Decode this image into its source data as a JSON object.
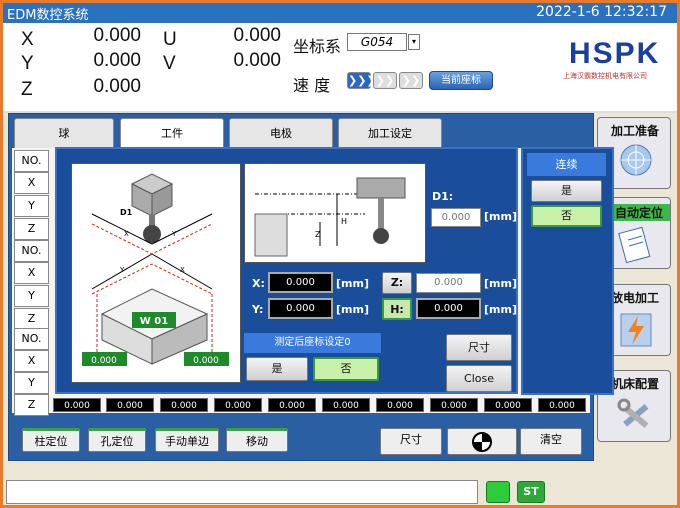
{
  "titlebar": {
    "title": "EDM数控系统",
    "datetime": "2022-1-6 12:32:17"
  },
  "axes": [
    {
      "name": "X",
      "value": "0.000"
    },
    {
      "name": "Y",
      "value": "0.000"
    },
    {
      "name": "Z",
      "value": "0.000"
    },
    {
      "name": "U",
      "value": "0.000"
    },
    {
      "name": "V",
      "value": "0.000"
    }
  ],
  "coord": {
    "label": "坐标系",
    "value": "G054"
  },
  "speed": {
    "label": "速  度",
    "btn1": "❯❯❯",
    "btn2": "❯❯",
    "btn3": "❯❯",
    "current_btn": "当前座标"
  },
  "logo": {
    "text": "HSPK",
    "subtitle": "上海汉霸数控机电有限公司"
  },
  "tabs": [
    "球",
    "工件",
    "电极",
    "加工设定"
  ],
  "rows": [
    "NO.",
    "X",
    "Y",
    "Z",
    "NO.",
    "X",
    "Y",
    "Z",
    "NO.",
    "X",
    "Y",
    "Z"
  ],
  "bottom_values": [
    "0.000",
    "0.000",
    "0.000",
    "0.000",
    "0.000",
    "0.000",
    "0.000",
    "0.000",
    "0.000",
    "0.000"
  ],
  "bottom_buttons": {
    "col": "柱定位",
    "hole": "孔定位",
    "manual": "手动单边",
    "move": "移动",
    "size": "尺寸",
    "clear": "清空"
  },
  "side": {
    "prep": "加工准备",
    "auto": "自动定位",
    "edm": "放电加工",
    "config": "机床配置"
  },
  "dialog": {
    "d1_label": "D1:",
    "d1_value": "0.000",
    "unit": "[mm]",
    "x_label": "X:",
    "x_value": "0.000",
    "y_label": "Y:",
    "y_value": "0.000",
    "z_btn": "Z:",
    "z_value": "0.000",
    "h_btn": "H:",
    "h_value": "0.000",
    "set_label": "测定后座标设定0",
    "yes": "是",
    "no": "否",
    "size": "尺寸",
    "close": "Close",
    "w_label": "W 01",
    "left_val": "0.000",
    "right_val": "0.000",
    "img_labels": {
      "d1": "D1",
      "x": "X",
      "y": "Y",
      "z": "Z",
      "h": "H"
    }
  },
  "continue": {
    "title": "连续",
    "yes": "是",
    "no": "否"
  },
  "status": {
    "st": "ST"
  }
}
